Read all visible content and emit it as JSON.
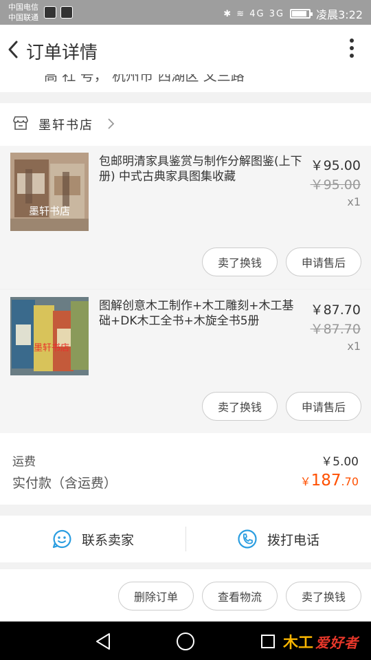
{
  "status_bar": {
    "carrier_1": "中国电信",
    "carrier_2": "中国联通",
    "indicators": "✱ ≋ 4G 3G",
    "time": "凌晨3:22"
  },
  "header": {
    "title": "订单详情"
  },
  "address": {
    "text": "高 社 号， 杭州市 西湖区 文三路"
  },
  "shop": {
    "name": "墨轩书店"
  },
  "items": [
    {
      "title": "包邮明清家具鉴赏与制作分解图鉴(上下册) 中式古典家具图集收藏",
      "price": "￥95.00",
      "original_price": "￥95.00",
      "quantity": "x1",
      "image_text": "墨轩书店",
      "sell_button": "卖了换钱",
      "after_sale_button": "申请售后"
    },
    {
      "title": "图解创意木工制作+木工雕刻+木工基础+DK木工全书+木旋全书5册",
      "price": "￥87.70",
      "original_price": "￥87.70",
      "quantity": "x1",
      "image_text": "墨轩书店",
      "sell_button": "卖了换钱",
      "after_sale_button": "申请售后"
    }
  ],
  "summary": {
    "shipping_label": "运费",
    "shipping_value": "￥5.00",
    "paid_label": "实付款（含运费）",
    "paid_currency": "￥",
    "paid_integer": "187",
    "paid_decimal": ".70"
  },
  "contact": {
    "seller_label": "联系卖家",
    "phone_label": "拨打电话"
  },
  "actions": {
    "delete_label": "删除订单",
    "logistics_label": "查看物流",
    "sell_label": "卖了换钱"
  },
  "watermark": {
    "logo": "木工",
    "text": "爱好者"
  },
  "colors": {
    "accent": "#ff5000",
    "icon_blue": "#2a9de0",
    "status_bar": "#9e9e9e"
  }
}
